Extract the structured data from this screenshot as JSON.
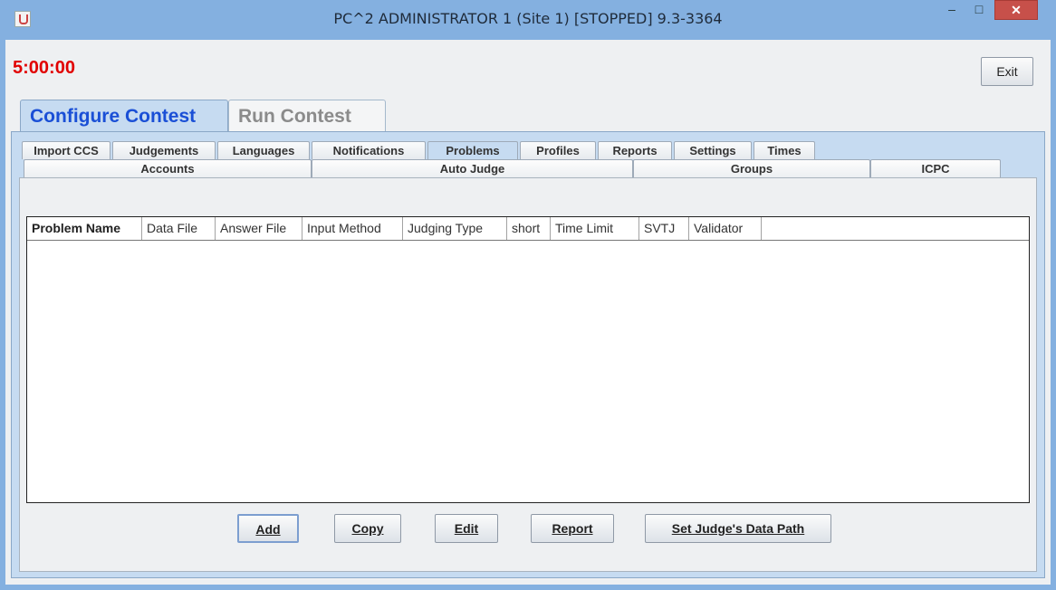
{
  "window": {
    "title": "PC^2 ADMINISTRATOR 1 (Site 1) [STOPPED] 9.3-3364",
    "minimize": "‒",
    "maximize": "□",
    "close": "✕"
  },
  "timer": "5:00:00",
  "exit_label": "Exit",
  "main_tabs": [
    {
      "label": "Configure Contest",
      "active": true
    },
    {
      "label": "Run Contest",
      "active": false
    }
  ],
  "sub_tabs_row1": [
    "Import CCS",
    "Judgements",
    "Languages",
    "Notifications",
    "Problems",
    "Profiles",
    "Reports",
    "Settings",
    "Times"
  ],
  "sub_tabs_row2": [
    "Accounts",
    "Auto Judge",
    "Groups",
    "ICPC"
  ],
  "active_sub_tab": "Problems",
  "table": {
    "columns": [
      "Problem Name",
      "Data File",
      "Answer File",
      "Input Method",
      "Judging Type",
      "short",
      "Time Limit",
      "SVTJ",
      "Validator"
    ]
  },
  "buttons": {
    "add": "Add",
    "copy": "Copy",
    "edit": "Edit",
    "report": "Report",
    "set_path": "Set Judge's Data Path"
  },
  "colors": {
    "timer": "#e10000",
    "active_tab_text": "#1a4fd6",
    "close_button": "#c7504a"
  }
}
